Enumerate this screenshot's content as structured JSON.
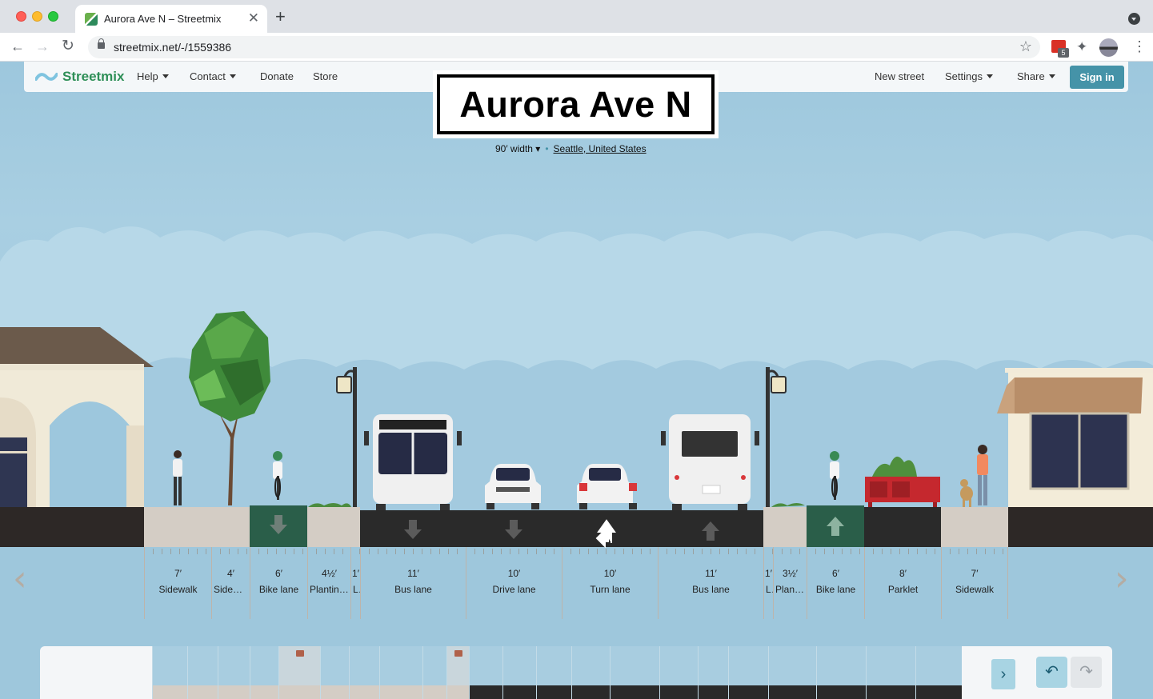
{
  "browser": {
    "tab_title": "Aurora Ave N – Streetmix",
    "url": "streetmix.net/-/1559386",
    "extension_badge": "5"
  },
  "menubar": {
    "logo": "Streetmix",
    "help": "Help",
    "contact": "Contact",
    "donate": "Donate",
    "store": "Store",
    "new_street": "New street",
    "settings": "Settings",
    "share": "Share",
    "sign_in": "Sign in"
  },
  "street": {
    "name": "Aurora Ave N",
    "width": "90′ width",
    "location": "Seattle, United States"
  },
  "segments": [
    {
      "width": "7′",
      "name": "Sidewalk"
    },
    {
      "width": "4′",
      "name": "Sidewalk"
    },
    {
      "width": "6′",
      "name": "Bike lane",
      "direction": "inbound"
    },
    {
      "width": "4½′",
      "name": "Planting strip"
    },
    {
      "width": "1′",
      "name": "Lamp"
    },
    {
      "width": "11′",
      "name": "Bus lane",
      "direction": "inbound"
    },
    {
      "width": "10′",
      "name": "Drive lane",
      "direction": "inbound"
    },
    {
      "width": "10′",
      "name": "Turn lane",
      "direction": "left-straight"
    },
    {
      "width": "11′",
      "name": "Bus lane",
      "direction": "outbound"
    },
    {
      "width": "1′",
      "name": "Lamp"
    },
    {
      "width": "3½′",
      "name": "Planting strip"
    },
    {
      "width": "6′",
      "name": "Bike lane",
      "direction": "outbound"
    },
    {
      "width": "8′",
      "name": "Parklet"
    },
    {
      "width": "7′",
      "name": "Sidewalk"
    }
  ],
  "colors": {
    "sky": "#a9cfe2",
    "road": "#2a2a2a",
    "bike_lane": "#2a5e49",
    "sidewalk": "#d4cdc5",
    "brand_green": "#2e8f57",
    "signin": "#4593a8"
  },
  "palette": {
    "items": [
      "sidewalk",
      "sidewalk-tree",
      "sidewalk-bike-rack",
      "sidewalk-bench",
      "sidewalk-wayfinding-locked",
      "sidewalk-ad",
      "sidewalk-lamp",
      "parklet",
      "planting-strip",
      "divider-locked",
      "bike-share",
      "scooter",
      "bike-lane",
      "bike-rack",
      "bus-lane-food-truck",
      "taxi-drive",
      "parking-meter",
      "drive-lane",
      "drive-lane-2",
      "turn-lane",
      "bus-lane",
      "streetcar",
      "light-rail"
    ],
    "locked_icon": "lock-icon",
    "scroll_icon": "chevron-right-icon",
    "undo_icon": "undo-icon",
    "redo_icon": "redo-icon"
  }
}
